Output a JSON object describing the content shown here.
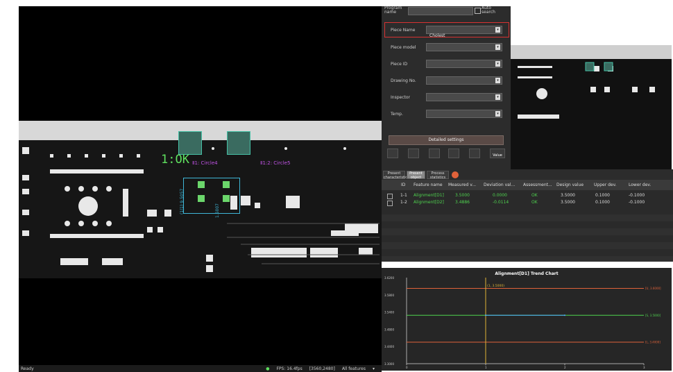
{
  "status": {
    "ready": "Ready",
    "fps": "FPS: 16.4fps",
    "coords": "[3560,2480]",
    "filter": "All features"
  },
  "overlay": {
    "ok_label": "1:OK",
    "feat1": "Ⅱ1:  Circle4",
    "feat2": "Ⅱ1:2:  Circle5",
    "dim1": "(1|1) 9.5057",
    "dim2": "1.5007"
  },
  "form": {
    "program_name_label": "Program name",
    "auto_search_label": "Auto search",
    "piece_name_label": "Piece Name",
    "piece_name_value": "Cholest",
    "piece_model_label": "Piece model",
    "piece_id_label": "Piece ID",
    "drawing_no_label": "Drawing No.",
    "inspector_label": "Inspector",
    "temp_label": "Temp.",
    "detailed_settings_label": "Detailed settings",
    "value_button_label": "Value"
  },
  "tabs": [
    "Present characteristics",
    "Present object",
    "Process statistics"
  ],
  "table": {
    "headers": [
      "ID",
      "Feature name",
      "Measured v...",
      "Deviation val...",
      "Assessment...",
      "Design value",
      "Upper dev.",
      "Lower dev."
    ],
    "rows": [
      [
        "1-1",
        "Alignment[D1]",
        "3.5000",
        "0.0000",
        "OK",
        "3.5000",
        "0.1000",
        "-0.1000"
      ],
      [
        "1-2",
        "Alignment[D2]",
        "3.4886",
        "-0.0114",
        "OK",
        "3.5000",
        "0.1000",
        "-0.1000"
      ]
    ]
  },
  "chart_data": {
    "type": "line",
    "title": "Alignment[D1] Trend Chart",
    "annotation": "(1, 3.5000)",
    "x_ticks": [
      "0",
      "1",
      "2",
      "3"
    ],
    "y_ticks": [
      "3.6200",
      "3.5800",
      "3.5400",
      "3.4800",
      "3.4400",
      "3.3000"
    ],
    "series": [
      {
        "values": [
          [
            1,
            3.5
          ],
          [
            2,
            3.5
          ]
        ],
        "color": "#4fb0ff"
      }
    ],
    "ref_lines": [
      {
        "label": "[U, 3.6000]",
        "value": 3.6,
        "color": "#e0623a"
      },
      {
        "label": "[S, 3.5000]",
        "value": 3.5,
        "color": "#4fd34f"
      },
      {
        "label": "[L, 3.4000]",
        "value": 3.4,
        "color": "#e0623a"
      }
    ],
    "xlim": [
      0,
      3
    ],
    "ylim": [
      3.32,
      3.64
    ]
  }
}
